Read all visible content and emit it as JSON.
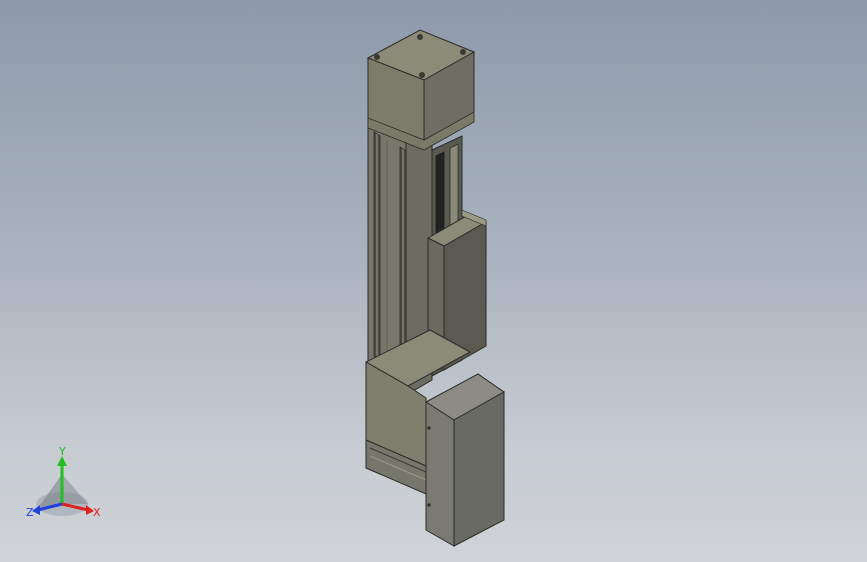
{
  "viewport": {
    "background_top": "#8e9aab",
    "background_bottom": "#d0d3d7"
  },
  "model": {
    "body_color": "#7f7f6d",
    "dark_face_color": "#4f5048",
    "enclosure_color": "#6f706a"
  },
  "triad": {
    "x_label": "X",
    "y_label": "Y",
    "z_label": "Z",
    "x_color": "#e02020",
    "y_color": "#20c020",
    "z_color": "#2040e0"
  }
}
